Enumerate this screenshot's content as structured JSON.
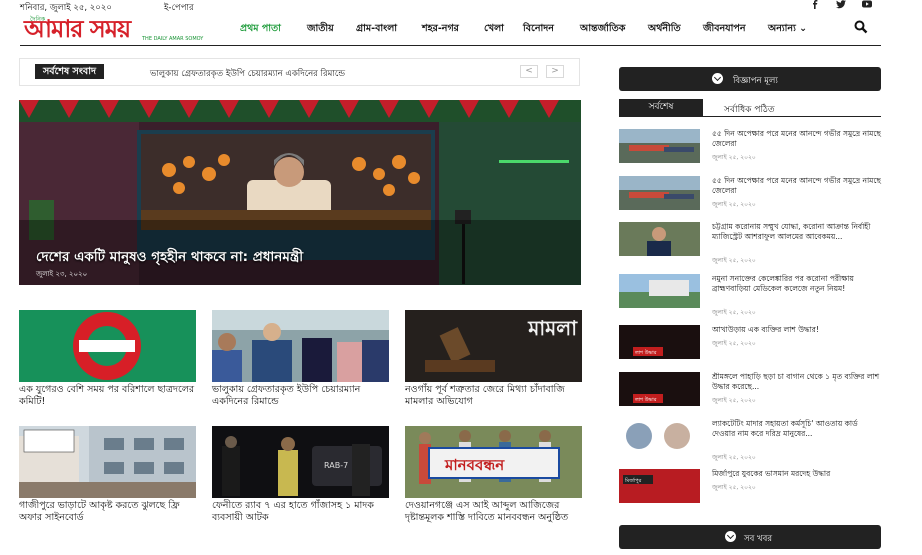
{
  "topbar": {
    "date": "শনিবার, জুলাই ২৫, ২০২০",
    "epaper": "ই-পেপার",
    "social": [
      "facebook-icon",
      "twitter-icon",
      "youtube-icon"
    ]
  },
  "logo": {
    "small": "দৈনিক",
    "main": "আমার সময়",
    "english": "THE DAILY AMAR SOMOY"
  },
  "nav": {
    "items": [
      "প্রথম পাতা",
      "জাতীয়",
      "গ্রাম-বাংলা",
      "শহর-নগর",
      "খেলা",
      "বিনোদন",
      "আন্তর্জাতিক",
      "অর্থনীতি",
      "জীবনযাপন",
      "অন্যান্য"
    ],
    "active_index": 0
  },
  "breaking": {
    "label": "সর্বশেষ সংবাদ",
    "text": "ভালুকায় গ্রেফতারকৃত ইউপি চেয়ারম্যান একদিনের রিমান্ডে",
    "prev": "<",
    "next": ">"
  },
  "hero": {
    "title": "দেশের একটি মানুষও গৃহহীন থাকবে না: প্রধানমন্ত্রী",
    "date": "জুলাই ২৩, ২০২০"
  },
  "cards": [
    {
      "title": "এক যুগেরও বেশি সময় পর বরিশালে ছাত্রদলের কমিটি!",
      "img_text": "বাংলাদেশ জাতীয়তাবাদী ছাত্রদল"
    },
    {
      "title": "ভালুকায় গ্রেফতারকৃত ইউপি চেয়ারম্যান একদিনের রিমান্ডে"
    },
    {
      "title": "নওগাঁয় পূর্ব শত্রুতার জেরে মিথ্যা চাঁদাবাজি মামলার অভিযোগ",
      "img_text": "মামলা"
    },
    {
      "title": "গাজীপুরে ভাড়াটে আকৃষ্ট করতে ঝুলছে ফ্রি অফার সাইনবোর্ড"
    },
    {
      "title": "ফেনীতে র‍্যাব ৭ এর হাতে গাঁজাসহ ১ মাদক ব্যবসায়ী আটক",
      "img_text": "RAB-7"
    },
    {
      "title": "দেওয়ানগঞ্জে এস আই আব্দুল আজিজের দৃষ্টান্তমূলক শাস্তি দাবিতে মানববন্ধন অনুষ্ঠিত",
      "img_text": "মানববন্ধন"
    }
  ],
  "sidebar": {
    "ad_rate": "বিজ্ঞাপন মূল্য",
    "tab_latest": "সর্বশেষ",
    "tab_popular": "সর্বাধিক পঠিত",
    "items": [
      {
        "title": "৫৫ দিন অপেক্ষার পরে মনের আনন্দে গভীর সমুদ্রে নামছে জেলেরা",
        "date": "জুলাই ২৫, ২০২০"
      },
      {
        "title": "৫৫ দিন অপেক্ষার পরে মনের আনন্দে গভীর সমুদ্রে নামছে জেলেরা",
        "date": "জুলাই ২৫, ২০২০"
      },
      {
        "title": "চট্টগ্রাম করোনায় সম্মুখ যোদ্ধা, করোনা আক্রান্ত নির্বাহী ম্যাজিস্ট্রেট আশরাফুল আলমের আবেকময়...",
        "date": "জুলাই ২৫, ২০২০"
      },
      {
        "title": "নমুনা সনাক্তের কেলেঙ্কারির পর করোনা পরীক্ষায় ব্রাহ্মণবাড়িয়া মেডিকেল কলেজে নতুন নিয়ম!",
        "date": "জুলাই ২৫, ২০২০"
      },
      {
        "title": "আখাউড়ায় এক ব্যক্তির লাশ উদ্ধার!",
        "date": "জুলাই ২৫, ২০২০",
        "img_text": "লাশ উদ্ধার"
      },
      {
        "title": "শ্রীমঙ্গলে পাহাড়ি ছড়া চা বাগান থেকে ১ মৃত ব্যক্তির লাশ উদ্ধার করেছে...",
        "date": "জুলাই ২৫, ২০২০",
        "img_text": "লাশ উদ্ধার"
      },
      {
        "title": "ল্যাকটেটিং মাদার সহায়তা কর্মসূচি' আওতায় কার্ড দেওয়ার নাম করে দরিদ্র মানুষের...",
        "date": "জুলাই ২৫, ২০২০"
      },
      {
        "title": "মির্জাপুরে যুবকের ভাসমান মরদেহ উদ্ধার",
        "date": "জুলাই ২৫, ২০২০",
        "img_text": "মির্জাপুর"
      }
    ],
    "all_news": "সব খবর"
  },
  "colors": {
    "brand_red": "#d6212a",
    "brand_green": "#1d9b3a",
    "dark": "#222222"
  }
}
